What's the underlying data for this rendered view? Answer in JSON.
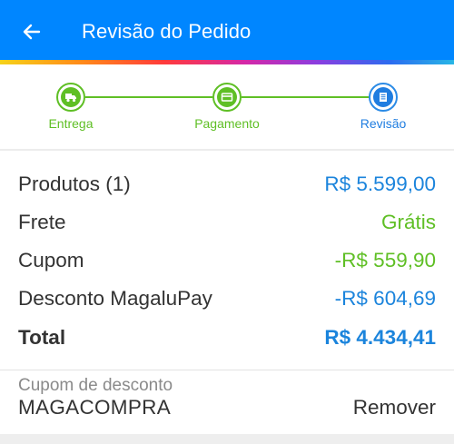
{
  "header": {
    "title": "Revisão do Pedido",
    "back_icon": "arrow-left-icon",
    "background_color": "#0086ff"
  },
  "stepper": {
    "steps": [
      {
        "label": "Entrega",
        "icon": "truck-icon",
        "state": "done"
      },
      {
        "label": "Pagamento",
        "icon": "credit-card-icon",
        "state": "done"
      },
      {
        "label": "Revisão",
        "icon": "document-icon",
        "state": "current"
      }
    ],
    "done_color": "#5fbf25",
    "current_color": "#1f7de0"
  },
  "summary": {
    "products": {
      "label": "Produtos (1)",
      "value": "R$ 5.599,00"
    },
    "shipping": {
      "label": "Frete",
      "value": "Grátis"
    },
    "coupon": {
      "label": "Cupom",
      "value": "-R$ 559,90"
    },
    "discount": {
      "label": "Desconto MagaluPay",
      "value": "-R$ 604,69"
    },
    "total": {
      "label": "Total",
      "value": "R$ 4.434,41"
    }
  },
  "coupon_section": {
    "label": "Cupom de desconto",
    "code": "MAGACOMPRA",
    "remove_label": "Remover"
  }
}
